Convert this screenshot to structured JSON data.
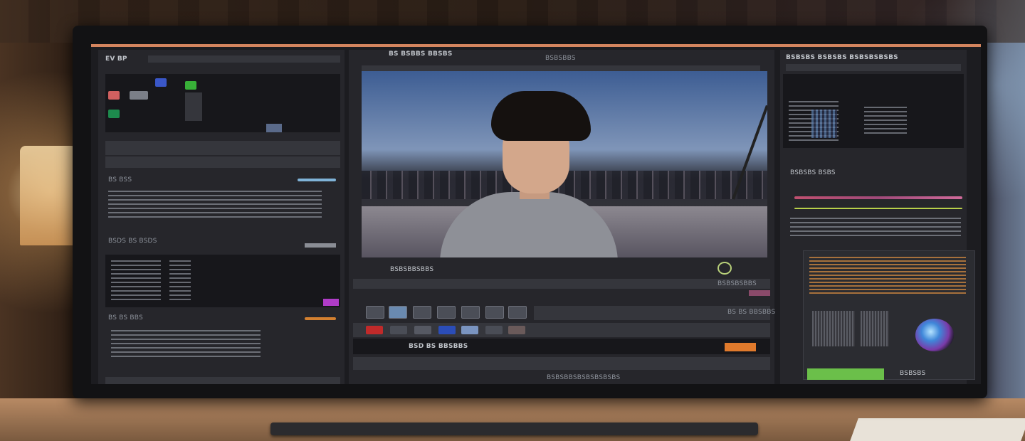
{
  "left_panel": {
    "header": "EV BP",
    "section_a": "BS BSS",
    "section_b": "BSDS BS BSDS",
    "section_c": "BS BS BBS"
  },
  "viewer": {
    "toolbar_left": "BS BSBBS BBSBS",
    "toolbar_right": "BSBSBBS",
    "caption": "BSBSBBSBBS",
    "timecode": "BSBSBSBBS",
    "bottom_label": "BS BS BBSBBS",
    "action_label": "BSD BS BBSBBS",
    "footer": "BSBSBBSBSBSBSBSBS"
  },
  "right_panel": {
    "header": "BSBSBS BSBSBS BSBSBSBSBS",
    "section": "BSBSBS BSBS",
    "badge": "BSBSBS"
  },
  "colors": {
    "accent": "#d3845e",
    "orange": "#e07a2c",
    "green": "#6bbf4a",
    "purple": "#b03cc8"
  }
}
